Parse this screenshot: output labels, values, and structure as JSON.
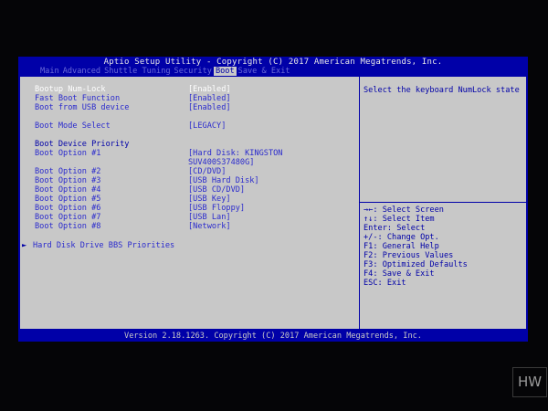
{
  "title": "Aptio Setup Utility - Copyright (C) 2017 American Megatrends, Inc.",
  "tabs": [
    "Main",
    "Advanced",
    "Shuttle Tuning",
    "Security",
    "Boot",
    "Save & Exit"
  ],
  "active_tab": "Boot",
  "settings": {
    "bootup_numlock": {
      "label": "Bootup Num-Lock",
      "value": "[Enabled]"
    },
    "fast_boot": {
      "label": "Fast Boot Function",
      "value": "[Enabled]"
    },
    "boot_usb": {
      "label": "Boot from USB device",
      "value": "[Enabled]"
    },
    "boot_mode": {
      "label": "Boot Mode Select",
      "value": "[LEGACY]"
    },
    "priority_header": "Boot Device Priority",
    "boot_options": [
      {
        "label": "Boot Option #1",
        "value": "[Hard Disk: KINGSTON",
        "value2": "SUV400S37480G]"
      },
      {
        "label": "Boot Option #2",
        "value": "[CD/DVD]"
      },
      {
        "label": "Boot Option #3",
        "value": "[USB Hard Disk]"
      },
      {
        "label": "Boot Option #4",
        "value": "[USB CD/DVD]"
      },
      {
        "label": "Boot Option #5",
        "value": "[USB Key]"
      },
      {
        "label": "Boot Option #6",
        "value": "[USB Floppy]"
      },
      {
        "label": "Boot Option #7",
        "value": "[USB Lan]"
      },
      {
        "label": "Boot Option #8",
        "value": "[Network]"
      }
    ],
    "bbs_arrow": "►",
    "bbs_priorities": "Hard Disk Drive BBS Priorities"
  },
  "help": {
    "text": "Select the keyboard NumLock state",
    "keys": [
      "→←: Select Screen",
      "↑↓: Select Item",
      "Enter: Select",
      "+/-: Change Opt.",
      "F1: General Help",
      "F2: Previous Values",
      "F3: Optimized Defaults",
      "F4: Save & Exit",
      "ESC: Exit"
    ]
  },
  "footer": "Version 2.18.1263. Copyright (C) 2017 American Megatrends, Inc.",
  "watermark": "HW"
}
